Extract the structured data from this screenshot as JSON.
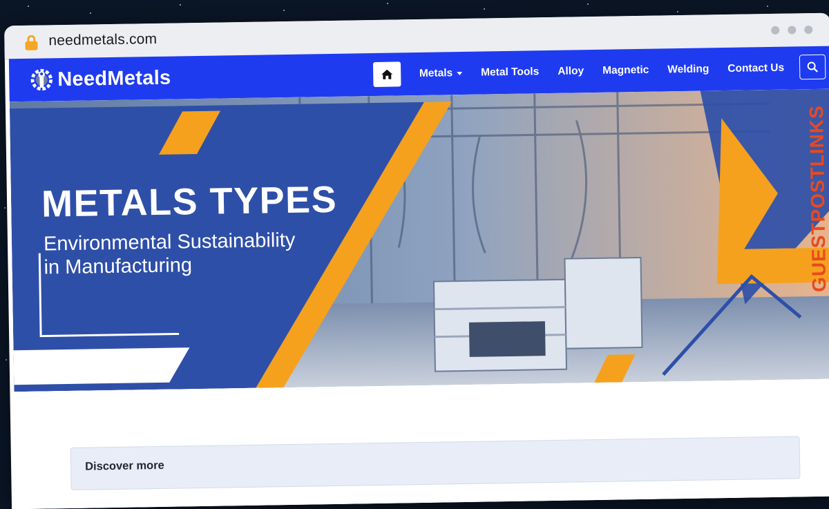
{
  "browser": {
    "url": "needmetals.com"
  },
  "navbar": {
    "brand": "NeedMetals",
    "menu": [
      {
        "label": "Metals",
        "has_dropdown": true
      },
      {
        "label": "Metal Tools"
      },
      {
        "label": "Alloy"
      },
      {
        "label": "Magnetic"
      },
      {
        "label": "Welding"
      },
      {
        "label": "Contact Us"
      }
    ],
    "background": "#1f3bf0"
  },
  "hero": {
    "title": "METALS TYPES",
    "subtitle_line1": "Environmental Sustainability",
    "subtitle_line2": "in Manufacturing",
    "accent": "#f5a11e",
    "panel_color": "#2e4fa8"
  },
  "watermark": {
    "text": "GUESTPOSTLINKS"
  },
  "content": {
    "discover_label": "Discover more"
  },
  "icons": {
    "home": "home-icon",
    "search": "search-icon",
    "lock": "lock-icon"
  }
}
